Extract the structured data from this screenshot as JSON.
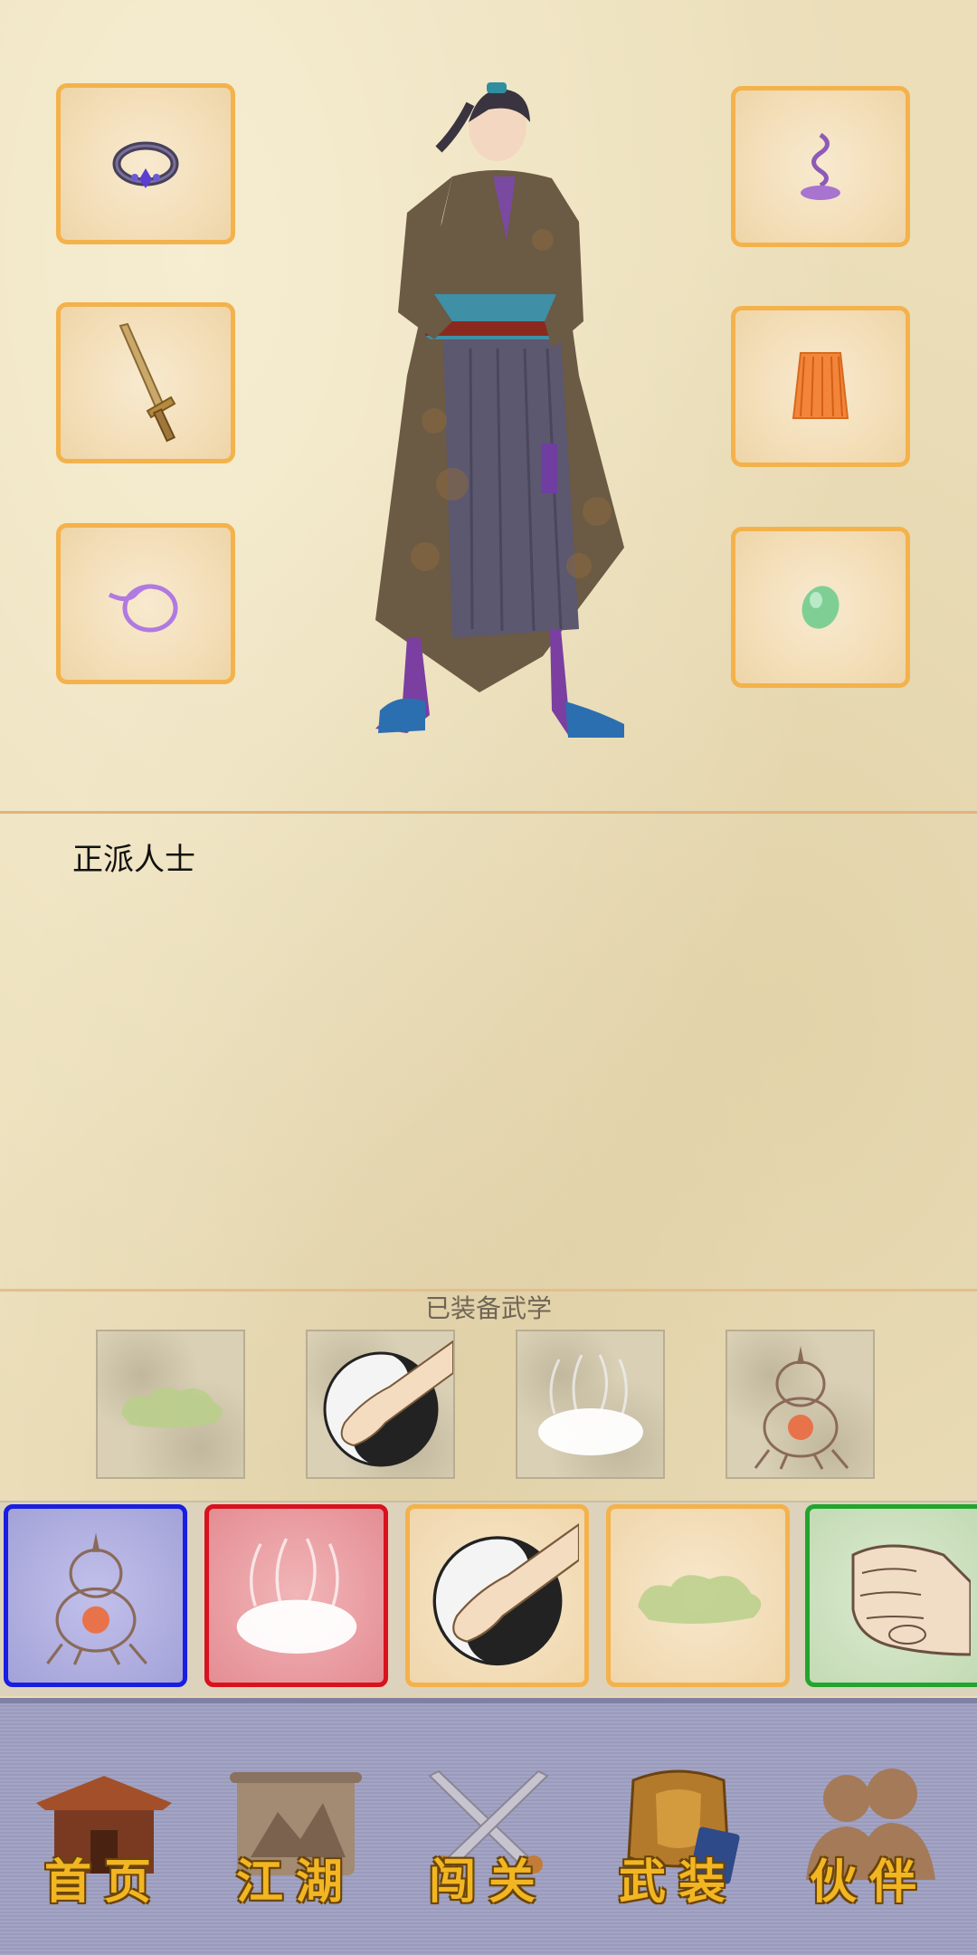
{
  "equipment": {
    "left_slots": [
      {
        "item": "ring-icon"
      },
      {
        "item": "sword-icon"
      },
      {
        "item": "ribbon-icon"
      }
    ],
    "right_slots": [
      {
        "item": "incense-icon"
      },
      {
        "item": "armor-icon"
      },
      {
        "item": "jade-icon"
      }
    ],
    "character": "swordsman-figure"
  },
  "profile": {
    "faction": "正派人士"
  },
  "skills": {
    "title": "已装备武学",
    "equipped": [
      "green-cloud-icon",
      "taiji-palm-icon",
      "white-mist-icon",
      "gourd-furnace-icon"
    ]
  },
  "cards": [
    {
      "icon": "gourd-furnace-icon",
      "border": "#1a1ee0",
      "bg": "#a9a8dc"
    },
    {
      "icon": "white-mist-icon",
      "border": "#d8121e",
      "bg": "#e9a0a4"
    },
    {
      "icon": "taiji-palm-icon",
      "border": "#f4b24c",
      "bg": "#f1dcb6"
    },
    {
      "icon": "green-cloud-icon",
      "border": "#f4b24c",
      "bg": "#f1dcb6"
    },
    {
      "icon": "fist-icon",
      "border": "#22a52e",
      "bg": "#cfe3c2"
    }
  ],
  "nav": {
    "items": [
      {
        "label": "首页",
        "icon": "house-icon"
      },
      {
        "label": "江湖",
        "icon": "scroll-map-icon"
      },
      {
        "label": "闯关",
        "icon": "crossed-swords-icon"
      },
      {
        "label": "武装",
        "icon": "armor-book-icon"
      },
      {
        "label": "伙伴",
        "icon": "companions-icon"
      }
    ]
  }
}
